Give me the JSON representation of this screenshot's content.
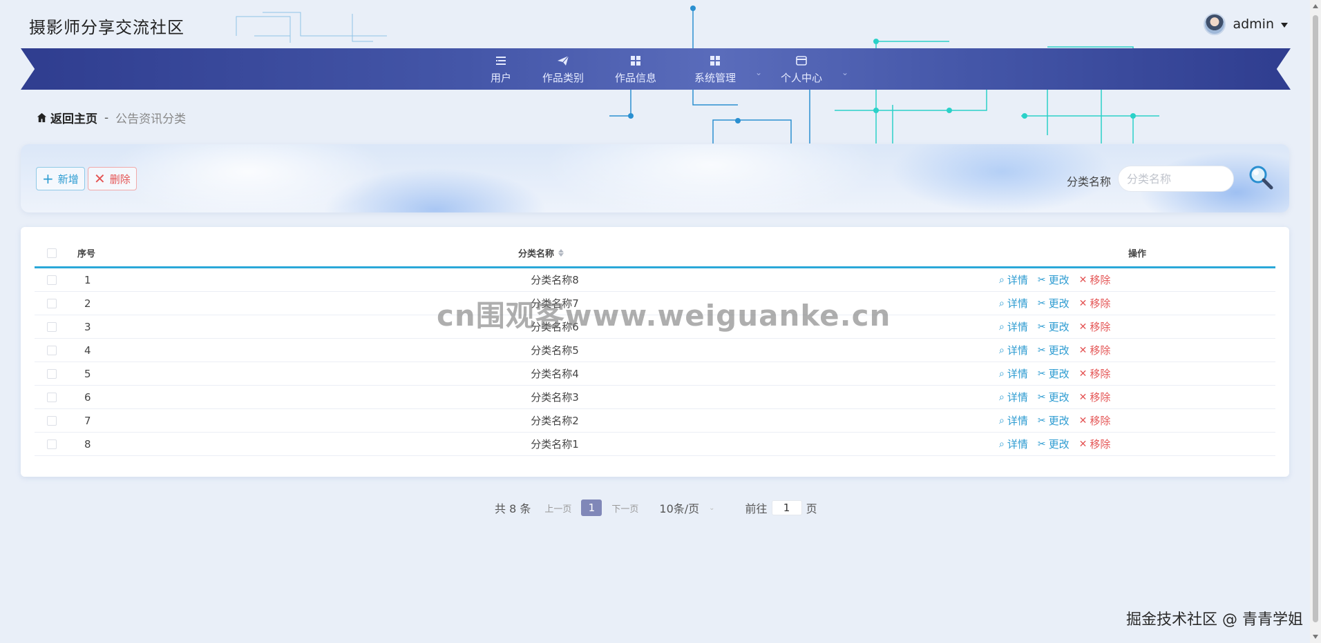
{
  "header": {
    "site_title": "摄影师分享交流社区",
    "user_name": "admin"
  },
  "nav": {
    "items": [
      {
        "label": "用户",
        "icon": "list-icon"
      },
      {
        "label": "作品类别",
        "icon": "paper-plane-icon"
      },
      {
        "label": "作品信息",
        "icon": "grid-icon"
      },
      {
        "label": "系统管理",
        "icon": "grid-icon"
      },
      {
        "label": "个人中心",
        "icon": "wallet-icon"
      }
    ]
  },
  "breadcrumb": {
    "home": "返回主页",
    "separator": "-",
    "current": "公告资讯分类"
  },
  "filter": {
    "add_label": "新增",
    "delete_label": "删除",
    "field_label": "分类名称",
    "field_placeholder": "分类名称",
    "field_value": ""
  },
  "table": {
    "headers": {
      "index": "序号",
      "name": "分类名称",
      "ops": "操作"
    },
    "actions": {
      "detail": "详情",
      "edit": "更改",
      "remove": "移除"
    },
    "rows": [
      {
        "index": "1",
        "name": "分类名称8"
      },
      {
        "index": "2",
        "name": "分类名称7"
      },
      {
        "index": "3",
        "name": "分类名称6"
      },
      {
        "index": "4",
        "name": "分类名称5"
      },
      {
        "index": "5",
        "name": "分类名称4"
      },
      {
        "index": "6",
        "name": "分类名称3"
      },
      {
        "index": "7",
        "name": "分类名称2"
      },
      {
        "index": "8",
        "name": "分类名称1"
      }
    ]
  },
  "pagination": {
    "total": "共 8 条",
    "prev": "上一页",
    "current": "1",
    "next": "下一页",
    "page_size": "10条/页",
    "goto_prefix": "前往",
    "goto_value": "1",
    "goto_suffix": "页"
  },
  "watermarks": {
    "center": "cn围观客www.weiguanke.cn",
    "corner": "掘金技术社区 @ 青青学姐"
  },
  "colors": {
    "accent": "#2aa8d8",
    "nav": "#4456a8",
    "danger": "#e45454",
    "page_bg": "#e9eff8"
  }
}
